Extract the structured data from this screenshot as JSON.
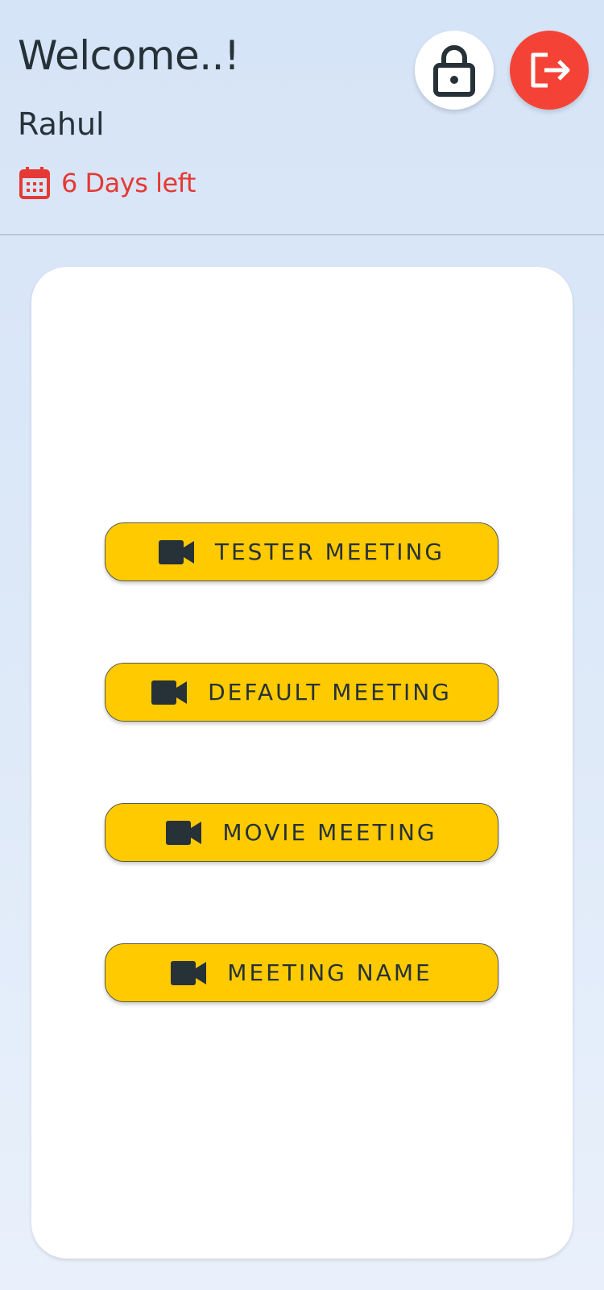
{
  "header": {
    "welcome": "Welcome..!",
    "username": "Rahul",
    "days_left": "6 Days left",
    "lock_icon": "lock-icon",
    "logout_icon": "logout-icon",
    "calendar_icon": "calendar-icon"
  },
  "colors": {
    "accent_yellow": "#ffca00",
    "logout_red": "#f44336",
    "days_left_red": "#e53935",
    "text_dark": "#263238"
  },
  "meetings": [
    {
      "label": "TESTER MEETING",
      "icon": "video-camera-icon"
    },
    {
      "label": "DEFAULT MEETING",
      "icon": "video-camera-icon"
    },
    {
      "label": "MOVIE MEETING",
      "icon": "video-camera-icon"
    },
    {
      "label": "MEETING NAME",
      "icon": "video-camera-icon"
    }
  ]
}
